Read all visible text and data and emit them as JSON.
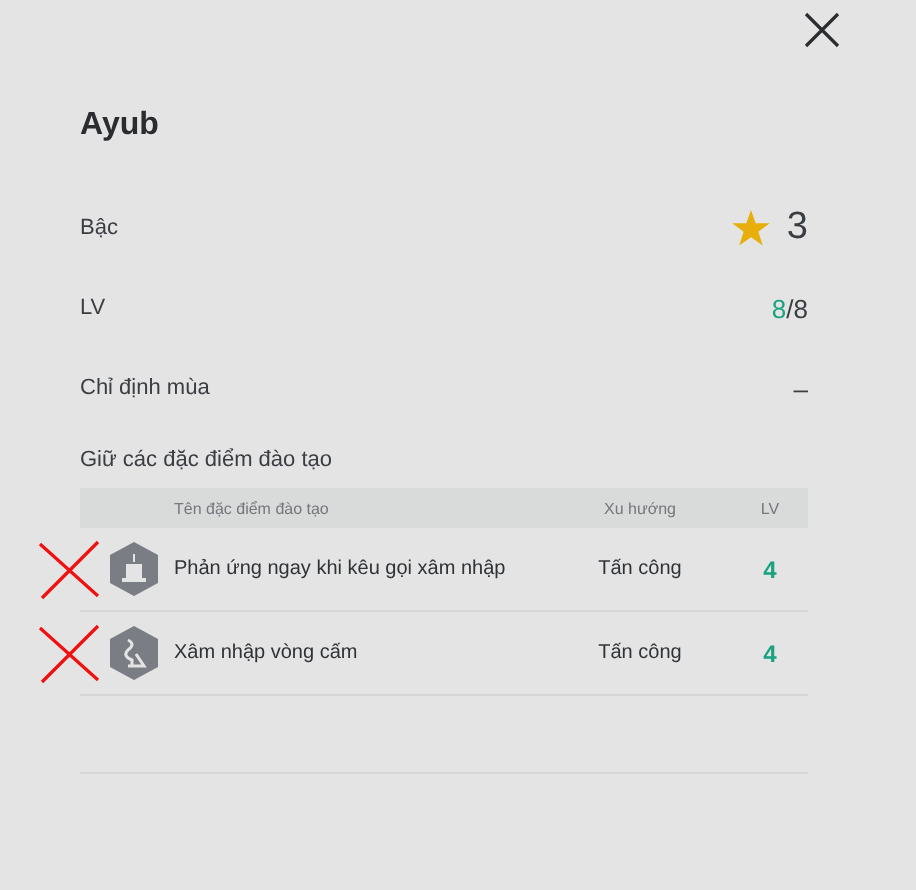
{
  "title": "Ayub",
  "rank": {
    "label": "Bậc",
    "value": "3"
  },
  "level": {
    "label": "LV",
    "current": "8",
    "rest": "/8"
  },
  "season": {
    "label": "Chỉ định mùa",
    "value": "–"
  },
  "traits": {
    "heading": "Giữ các đặc điểm đào tạo",
    "columns": [
      "Tên đặc điểm đào tạo",
      "Xu hướng",
      "LV"
    ],
    "rows": [
      {
        "kind": "alarm",
        "name": "Phản ứng ngay khi kêu gọi xâm nhập",
        "trend": "Tấn công",
        "lv": "4",
        "crossed_out": true
      },
      {
        "kind": "route",
        "name": "Xâm nhập vòng cấm",
        "trend": "Tấn công",
        "lv": "4",
        "crossed_out": true
      }
    ]
  }
}
